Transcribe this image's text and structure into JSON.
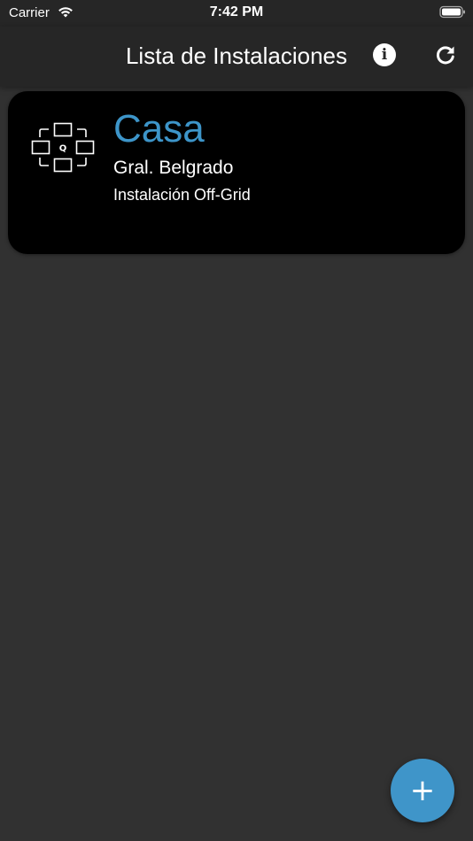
{
  "status_bar": {
    "carrier": "Carrier",
    "time": "7:42 PM",
    "wifi_icon": "wifi-icon",
    "battery_icon": "battery-icon"
  },
  "nav": {
    "title": "Lista de Instalaciones",
    "info_icon": "info-icon",
    "info_glyph": "i",
    "refresh_icon": "refresh-icon"
  },
  "installations": [
    {
      "name": "Casa",
      "location": "Gral. Belgrado",
      "type": "Instalación Off-Grid",
      "icon": "installation-logo-icon",
      "logo_letter": "Q"
    }
  ],
  "fab": {
    "label": "+",
    "icon": "add-icon"
  },
  "colors": {
    "background": "#313131",
    "nav_background": "#262626",
    "card_background": "#000000",
    "accent": "#3d95c9",
    "fab": "#3f95c9",
    "text": "#ffffff"
  }
}
